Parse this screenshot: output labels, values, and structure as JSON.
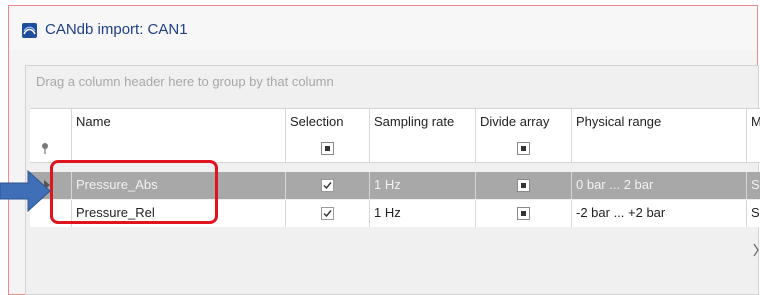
{
  "window": {
    "title": "CANdb import: CAN1"
  },
  "grid": {
    "group_hint": "Drag a column header here to group by that column",
    "columns": [
      "Name",
      "Selection",
      "Sampling rate",
      "Divide array",
      "Physical range",
      "M"
    ],
    "rows": [
      {
        "name": "Pressure_Abs",
        "selected": true,
        "sampling_rate": "1 Hz",
        "divide_array": "filled",
        "physical_range": "0 bar ... 2 bar",
        "m": "S",
        "highlighted": true
      },
      {
        "name": "Pressure_Rel",
        "selected": true,
        "sampling_rate": "1 Hz",
        "divide_array": "filled",
        "physical_range": "-2 bar ... +2 bar",
        "m": "S",
        "highlighted": false
      }
    ]
  },
  "colors": {
    "accent_red": "#e0141e",
    "arrow_blue": "#3f6fb6",
    "title_blue": "#1f3f86",
    "selected_row": "#a8a8a8"
  }
}
